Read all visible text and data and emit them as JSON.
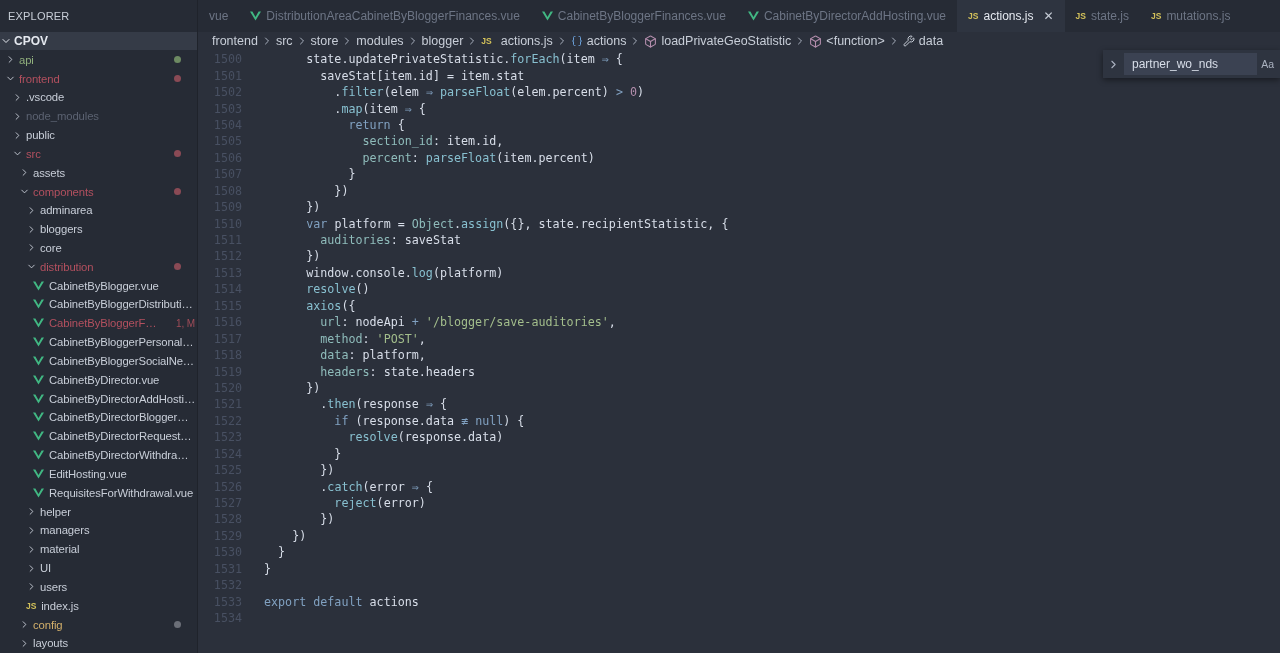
{
  "sidebar": {
    "title": "EXPLORER",
    "root": {
      "label": "CPOV",
      "expanded": true,
      "children": [
        {
          "label": "api",
          "kind": "untracked-folder",
          "expanded": false,
          "color": "#6d8a62"
        },
        {
          "label": "frontend",
          "kind": "modified-folder",
          "expanded": true,
          "color": "#8a4a55",
          "children": [
            {
              "label": ".vscode",
              "kind": "folder",
              "expanded": false
            },
            {
              "label": "node_modules",
              "kind": "ignored-folder",
              "expanded": false
            },
            {
              "label": "public",
              "kind": "folder",
              "expanded": false
            },
            {
              "label": "src",
              "kind": "modified-folder",
              "expanded": true,
              "color": "#8a4a55",
              "children": [
                {
                  "label": "assets",
                  "kind": "folder",
                  "expanded": false
                },
                {
                  "label": "components",
                  "kind": "modified-folder",
                  "expanded": true,
                  "color": "#8a4a55",
                  "children": [
                    {
                      "label": "adminarea",
                      "kind": "folder",
                      "expanded": false
                    },
                    {
                      "label": "bloggers",
                      "kind": "folder",
                      "expanded": false
                    },
                    {
                      "label": "core",
                      "kind": "folder",
                      "expanded": false
                    },
                    {
                      "label": "distribution",
                      "kind": "modified-folder",
                      "expanded": true,
                      "color": "#8a4a55",
                      "children": [
                        {
                          "label": "CabinetByBlogger.vue",
                          "kind": "vue"
                        },
                        {
                          "label": "CabinetByBloggerDistributi…",
                          "kind": "vue"
                        },
                        {
                          "label": "CabinetByBloggerF…",
                          "kind": "modified-vue",
                          "badge": "1, M"
                        },
                        {
                          "label": "CabinetByBloggerPersonal…",
                          "kind": "vue"
                        },
                        {
                          "label": "CabinetByBloggerSocialNe…",
                          "kind": "vue"
                        },
                        {
                          "label": "CabinetByDirector.vue",
                          "kind": "vue"
                        },
                        {
                          "label": "CabinetByDirectorAddHosti…",
                          "kind": "vue"
                        },
                        {
                          "label": "CabinetByDirectorBlogger…",
                          "kind": "vue"
                        },
                        {
                          "label": "CabinetByDirectorRequest…",
                          "kind": "vue"
                        },
                        {
                          "label": "CabinetByDirectorWithdra…",
                          "kind": "vue"
                        },
                        {
                          "label": "EditHosting.vue",
                          "kind": "vue"
                        },
                        {
                          "label": "RequisitesForWithdrawal.vue",
                          "kind": "vue"
                        }
                      ]
                    },
                    {
                      "label": "helper",
                      "kind": "folder",
                      "expanded": false
                    },
                    {
                      "label": "managers",
                      "kind": "folder",
                      "expanded": false
                    },
                    {
                      "label": "material",
                      "kind": "folder",
                      "expanded": false
                    },
                    {
                      "label": "UI",
                      "kind": "folder",
                      "expanded": false
                    },
                    {
                      "label": "users",
                      "kind": "folder",
                      "expanded": false
                    },
                    {
                      "label": "index.js",
                      "kind": "js",
                      "icon_text": "JS"
                    }
                  ]
                },
                {
                  "label": "config",
                  "kind": "warning-folder",
                  "expanded": false,
                  "color": "#6b6f78"
                },
                {
                  "label": "layouts",
                  "kind": "folder",
                  "expanded": false
                }
              ]
            }
          ]
        }
      ]
    }
  },
  "tabs": [
    {
      "label": "vue",
      "selected": false
    },
    {
      "label": "DistributionAreaCabinetByBloggerFinances.vue",
      "kind": "vue",
      "selected": false
    },
    {
      "label": "CabinetByBloggerFinances.vue",
      "kind": "vue",
      "selected": false
    },
    {
      "label": "CabinetByDirectorAddHosting.vue",
      "kind": "vue",
      "selected": false
    },
    {
      "label": "actions.js",
      "kind": "js",
      "icon_text": "JS",
      "selected": true,
      "close": "✕"
    },
    {
      "label": "state.js",
      "kind": "js",
      "icon_text": "JS",
      "selected": false
    },
    {
      "label": "mutations.js",
      "kind": "js",
      "icon_text": "JS",
      "selected": false
    }
  ],
  "breadcrumb": [
    {
      "label": "frontend",
      "kind": "folder"
    },
    {
      "label": "src",
      "kind": "folder"
    },
    {
      "label": "store",
      "kind": "folder"
    },
    {
      "label": "modules",
      "kind": "folder"
    },
    {
      "label": "blogger",
      "kind": "folder"
    },
    {
      "label": "actions.js",
      "kind": "js",
      "icon_text": "JS"
    },
    {
      "label": "actions",
      "kind": "variable"
    },
    {
      "label": "loadPrivateGeoStatistic",
      "kind": "method"
    },
    {
      "label": "<function>",
      "kind": "method"
    },
    {
      "label": "data",
      "kind": "field"
    }
  ],
  "find_widget": {
    "value": "partner_wo_nds",
    "case_toggle": "Aa"
  },
  "code": [
    {
      "number": "1500",
      "tokens": [
        {
          "text": "      state.updatePrivateStatistic.",
          "kind": "plain"
        },
        {
          "text": "forEach",
          "kind": "fn"
        },
        {
          "text": "(item ",
          "kind": "plain"
        },
        {
          "text": "⇒",
          "kind": "op"
        },
        {
          "text": " {",
          "kind": "plain"
        }
      ]
    },
    {
      "number": "1501",
      "tokens": [
        {
          "text": "        saveStat[item.id] = item.stat",
          "kind": "plain"
        }
      ]
    },
    {
      "number": "1502",
      "tokens": [
        {
          "text": "          .",
          "kind": "plain"
        },
        {
          "text": "filter",
          "kind": "fn"
        },
        {
          "text": "(elem ",
          "kind": "plain"
        },
        {
          "text": "⇒ ",
          "kind": "op"
        },
        {
          "text": "parseFloat",
          "kind": "fn"
        },
        {
          "text": "(elem.percent) ",
          "kind": "plain"
        },
        {
          "text": "> ",
          "kind": "op"
        },
        {
          "text": "0",
          "kind": "num"
        },
        {
          "text": ")",
          "kind": "plain"
        }
      ]
    },
    {
      "number": "1503",
      "tokens": [
        {
          "text": "          .",
          "kind": "plain"
        },
        {
          "text": "map",
          "kind": "fn"
        },
        {
          "text": "(item ",
          "kind": "plain"
        },
        {
          "text": "⇒",
          "kind": "op"
        },
        {
          "text": " {",
          "kind": "plain"
        }
      ]
    },
    {
      "number": "1504",
      "tokens": [
        {
          "text": "            return",
          "kind": "kw"
        },
        {
          "text": " {",
          "kind": "plain"
        }
      ]
    },
    {
      "number": "1505",
      "tokens": [
        {
          "text": "              section_id",
          "kind": "prop"
        },
        {
          "text": ": item.id,",
          "kind": "plain"
        }
      ]
    },
    {
      "number": "1506",
      "tokens": [
        {
          "text": "              percent",
          "kind": "prop"
        },
        {
          "text": ": ",
          "kind": "plain"
        },
        {
          "text": "parseFloat",
          "kind": "fn"
        },
        {
          "text": "(item.percent)",
          "kind": "plain"
        }
      ]
    },
    {
      "number": "1507",
      "tokens": [
        {
          "text": "            }",
          "kind": "plain"
        }
      ]
    },
    {
      "number": "1508",
      "tokens": [
        {
          "text": "          })",
          "kind": "plain"
        }
      ]
    },
    {
      "number": "1509",
      "tokens": [
        {
          "text": "      })",
          "kind": "plain"
        }
      ]
    },
    {
      "number": "1510",
      "tokens": [
        {
          "text": "      var",
          "kind": "kw"
        },
        {
          "text": " platform = ",
          "kind": "plain"
        },
        {
          "text": "Object",
          "kind": "prop"
        },
        {
          "text": ".",
          "kind": "plain"
        },
        {
          "text": "assign",
          "kind": "fn"
        },
        {
          "text": "({}, state.recipientStatistic, {",
          "kind": "plain"
        }
      ]
    },
    {
      "number": "1511",
      "tokens": [
        {
          "text": "        auditories",
          "kind": "prop"
        },
        {
          "text": ": saveStat",
          "kind": "plain"
        }
      ]
    },
    {
      "number": "1512",
      "tokens": [
        {
          "text": "      })",
          "kind": "plain"
        }
      ]
    },
    {
      "number": "1513",
      "tokens": [
        {
          "text": "      window.console.",
          "kind": "plain"
        },
        {
          "text": "log",
          "kind": "fn"
        },
        {
          "text": "(platform)",
          "kind": "plain"
        }
      ]
    },
    {
      "number": "1514",
      "tokens": [
        {
          "text": "      resolve",
          "kind": "fn"
        },
        {
          "text": "()",
          "kind": "plain"
        }
      ]
    },
    {
      "number": "1515",
      "tokens": [
        {
          "text": "      axios",
          "kind": "fn"
        },
        {
          "text": "({",
          "kind": "plain"
        }
      ]
    },
    {
      "number": "1516",
      "tokens": [
        {
          "text": "        url",
          "kind": "prop"
        },
        {
          "text": ": nodeApi ",
          "kind": "plain"
        },
        {
          "text": "+ ",
          "kind": "op"
        },
        {
          "text": "'/blogger/save-auditories'",
          "kind": "str"
        },
        {
          "text": ",",
          "kind": "plain"
        }
      ]
    },
    {
      "number": "1517",
      "tokens": [
        {
          "text": "        method",
          "kind": "prop"
        },
        {
          "text": ": ",
          "kind": "plain"
        },
        {
          "text": "'POST'",
          "kind": "str"
        },
        {
          "text": ",",
          "kind": "plain"
        }
      ]
    },
    {
      "number": "1518",
      "tokens": [
        {
          "text": "        data",
          "kind": "prop"
        },
        {
          "text": ": platform,",
          "kind": "plain"
        }
      ]
    },
    {
      "number": "1519",
      "tokens": [
        {
          "text": "        headers",
          "kind": "prop"
        },
        {
          "text": ": state.headers",
          "kind": "plain"
        }
      ]
    },
    {
      "number": "1520",
      "tokens": [
        {
          "text": "      })",
          "kind": "plain"
        }
      ]
    },
    {
      "number": "1521",
      "tokens": [
        {
          "text": "        .",
          "kind": "plain"
        },
        {
          "text": "then",
          "kind": "fn"
        },
        {
          "text": "(response ",
          "kind": "plain"
        },
        {
          "text": "⇒",
          "kind": "op"
        },
        {
          "text": " {",
          "kind": "plain"
        }
      ]
    },
    {
      "number": "1522",
      "tokens": [
        {
          "text": "          if",
          "kind": "kw"
        },
        {
          "text": " (response.data ",
          "kind": "plain"
        },
        {
          "text": "≢ ",
          "kind": "op"
        },
        {
          "text": "null",
          "kind": "kw"
        },
        {
          "text": ") {",
          "kind": "plain"
        }
      ]
    },
    {
      "number": "1523",
      "tokens": [
        {
          "text": "            resolve",
          "kind": "fn"
        },
        {
          "text": "(response.data)",
          "kind": "plain"
        }
      ]
    },
    {
      "number": "1524",
      "tokens": [
        {
          "text": "          }",
          "kind": "plain"
        }
      ]
    },
    {
      "number": "1525",
      "tokens": [
        {
          "text": "        })",
          "kind": "plain"
        }
      ]
    },
    {
      "number": "1526",
      "tokens": [
        {
          "text": "        .",
          "kind": "plain"
        },
        {
          "text": "catch",
          "kind": "fn"
        },
        {
          "text": "(error ",
          "kind": "plain"
        },
        {
          "text": "⇒",
          "kind": "op"
        },
        {
          "text": " {",
          "kind": "plain"
        }
      ]
    },
    {
      "number": "1527",
      "tokens": [
        {
          "text": "          reject",
          "kind": "fn"
        },
        {
          "text": "(error)",
          "kind": "plain"
        }
      ]
    },
    {
      "number": "1528",
      "tokens": [
        {
          "text": "        })",
          "kind": "plain"
        }
      ]
    },
    {
      "number": "1529",
      "tokens": [
        {
          "text": "    })",
          "kind": "plain"
        }
      ]
    },
    {
      "number": "1530",
      "tokens": [
        {
          "text": "  }",
          "kind": "plain"
        }
      ]
    },
    {
      "number": "1531",
      "tokens": [
        {
          "text": "}",
          "kind": "plain"
        }
      ]
    },
    {
      "number": "1532"
    },
    {
      "number": "1533",
      "tokens": [
        {
          "text": "export default",
          "kind": "kw"
        },
        {
          "text": " actions",
          "kind": "plain"
        }
      ]
    },
    {
      "number": "1534"
    }
  ]
}
